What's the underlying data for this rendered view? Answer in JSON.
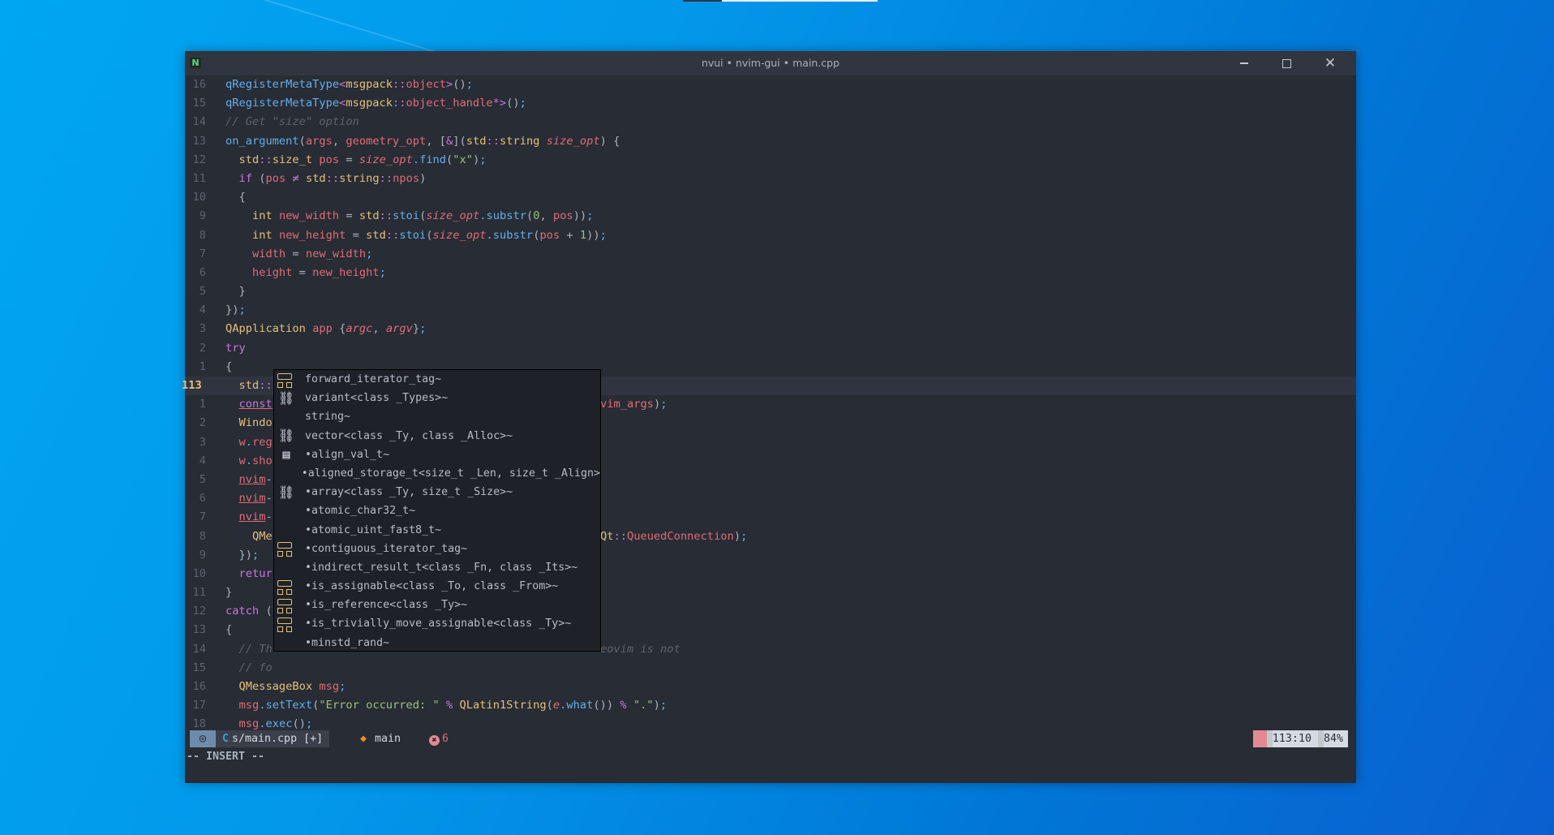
{
  "desktop": {
    "accent": "#0078d7"
  },
  "window": {
    "app_icon": "N",
    "title": "nvui • nvim-gui • main.cpp",
    "controls": {
      "minimize": "minimize",
      "maximize": "maximize",
      "close": "✕"
    }
  },
  "editor": {
    "lines": [
      {
        "num": "16",
        "code": "qRegisterMetaType<msgpack::object>();"
      },
      {
        "num": "15",
        "code": "qRegisterMetaType<msgpack::object_handle*>();"
      },
      {
        "num": "14",
        "code": "// Get \"size\" option"
      },
      {
        "num": "13",
        "code": "on_argument(args, geometry_opt, [&](std::string size_opt) {"
      },
      {
        "num": "12",
        "code": "  std::size_t pos = size_opt.find(\"x\");"
      },
      {
        "num": "11",
        "code": "  if (pos ≠ std::string::npos)"
      },
      {
        "num": "10",
        "code": "  {"
      },
      {
        "num": "9",
        "code": "    int new_width = std::stoi(size_opt.substr(0, pos));"
      },
      {
        "num": "8",
        "code": "    int new_height = std::stoi(size_opt.substr(pos + 1));"
      },
      {
        "num": "7",
        "code": "    width = new_width;"
      },
      {
        "num": "6",
        "code": "    height = new_height;"
      },
      {
        "num": "5",
        "code": "  }"
      },
      {
        "num": "4",
        "code": "});"
      },
      {
        "num": "3",
        "code": "QApplication app {argc, argv};"
      },
      {
        "num": "2",
        "code": "try"
      },
      {
        "num": "1",
        "code": "{"
      },
      {
        "num": "113",
        "code": "  std::",
        "current": true
      },
      {
        "num": "1",
        "code": "  const",
        "tail": "vim_args);"
      },
      {
        "num": "2",
        "code": "  Windo"
      },
      {
        "num": "3",
        "code": "  w.reg"
      },
      {
        "num": "4",
        "code": "  w.sho"
      },
      {
        "num": "5",
        "code": "  nvim-"
      },
      {
        "num": "6",
        "code": "  nvim-"
      },
      {
        "num": "7",
        "code": "  nvim-"
      },
      {
        "num": "8",
        "code": "    QMe",
        "tail": "Qt::QueuedConnection);"
      },
      {
        "num": "9",
        "code": "  });"
      },
      {
        "num": "10",
        "code": "  retur"
      },
      {
        "num": "11",
        "code": "}"
      },
      {
        "num": "12",
        "code": "catch ("
      },
      {
        "num": "13",
        "code": "{"
      },
      {
        "num": "14",
        "code": "  // Th",
        "tail": "eovim is not"
      },
      {
        "num": "15",
        "code": "  // fo"
      },
      {
        "num": "16",
        "code": "  QMessageBox msg;"
      },
      {
        "num": "17",
        "code": "  msg.setText(\"Error occurred: \" % QLatin1String(e.what()) % \".\");"
      },
      {
        "num": "18",
        "code": "  msg.exec();"
      }
    ]
  },
  "completion_menu": {
    "items": [
      {
        "kind": "struct",
        "label": "forward_iterator_tag~"
      },
      {
        "kind": "class",
        "label": "variant<class _Types>~"
      },
      {
        "kind": "variable",
        "label": "string~"
      },
      {
        "kind": "class",
        "label": "vector<class _Ty, class _Alloc>~"
      },
      {
        "kind": "enum",
        "label": "•align_val_t~"
      },
      {
        "kind": "variable",
        "label": "•aligned_storage_t<size_t _Len, size_t _Align>"
      },
      {
        "kind": "class",
        "label": "•array<class _Ty, size_t _Size>~"
      },
      {
        "kind": "variable",
        "label": "•atomic_char32_t~"
      },
      {
        "kind": "variable",
        "label": "•atomic_uint_fast8_t~"
      },
      {
        "kind": "struct",
        "label": "•contiguous_iterator_tag~"
      },
      {
        "kind": "variable",
        "label": "•indirect_result_t<class _Fn, class _Its>~"
      },
      {
        "kind": "struct",
        "label": "•is_assignable<class _To, class _From>~"
      },
      {
        "kind": "struct",
        "label": "•is_reference<class _Ty>~"
      },
      {
        "kind": "struct",
        "label": "•is_trivially_move_assignable<class _Ty>~"
      },
      {
        "kind": "variable",
        "label": "•minstd_rand~"
      }
    ]
  },
  "statusbar": {
    "mode_icon": "◎",
    "file_icon": "C",
    "file": "s/main.cpp [+]",
    "git_icon": "◆",
    "branch": "main",
    "error_icon": "✖",
    "errors": "6",
    "position": "113:10",
    "percent": "84%"
  },
  "cmdline": {
    "mode": "-- INSERT --"
  }
}
